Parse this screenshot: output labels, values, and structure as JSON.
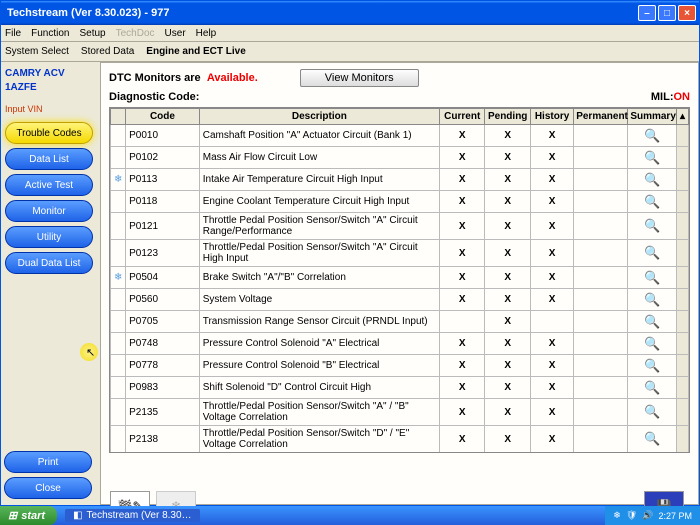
{
  "window": {
    "title": "Techstream (Ver 8.30.023) - 977"
  },
  "menubar": [
    "File",
    "Function",
    "Setup",
    "TechDoc",
    "User",
    "Help"
  ],
  "toolbar": {
    "items": [
      "System Select",
      "Stored Data",
      "Engine and ECT Live"
    ],
    "active": 2
  },
  "sidebar": {
    "vehicle_line1": "CAMRY ACV",
    "vehicle_line2": "1AZFE",
    "input_vin": "Input VIN",
    "buttons": [
      {
        "label": "Trouble Codes",
        "style": "yellow"
      },
      {
        "label": "Data List",
        "style": "blue"
      },
      {
        "label": "Active Test",
        "style": "blue"
      },
      {
        "label": "Monitor",
        "style": "blue"
      },
      {
        "label": "Utility",
        "style": "blue"
      },
      {
        "label": "Dual Data List",
        "style": "blue"
      }
    ],
    "bottom": [
      {
        "label": "Print"
      },
      {
        "label": "Close"
      }
    ]
  },
  "main": {
    "dtc_label": "DTC Monitors are",
    "dtc_status": "Available.",
    "view_monitors": "View Monitors",
    "diag_label": "Diagnostic Code:",
    "mil_label": "MIL:",
    "mil_value": "ON",
    "columns": [
      "",
      "Code",
      "Description",
      "Current",
      "Pending",
      "History",
      "Permanent",
      "Summary"
    ],
    "rows": [
      {
        "code": "P0010",
        "desc": "Camshaft Position \"A\" Actuator Circuit (Bank 1)",
        "cur": "X",
        "pen": "X",
        "his": "X",
        "flag": ""
      },
      {
        "code": "P0102",
        "desc": "Mass Air Flow Circuit Low",
        "cur": "X",
        "pen": "X",
        "his": "X",
        "flag": ""
      },
      {
        "code": "P0113",
        "desc": "Intake Air Temperature Circuit High Input",
        "cur": "X",
        "pen": "X",
        "his": "X",
        "flag": "snow"
      },
      {
        "code": "P0118",
        "desc": "Engine Coolant Temperature Circuit High Input",
        "cur": "X",
        "pen": "X",
        "his": "X",
        "flag": ""
      },
      {
        "code": "P0121",
        "desc": "Throttle Pedal Position Sensor/Switch \"A\" Circuit Range/Performance",
        "cur": "X",
        "pen": "X",
        "his": "X",
        "flag": ""
      },
      {
        "code": "P0123",
        "desc": "Throttle/Pedal Position Sensor/Switch \"A\" Circuit High Input",
        "cur": "X",
        "pen": "X",
        "his": "X",
        "flag": ""
      },
      {
        "code": "P0504",
        "desc": "Brake Switch \"A\"/\"B\" Correlation",
        "cur": "X",
        "pen": "X",
        "his": "X",
        "flag": "snow"
      },
      {
        "code": "P0560",
        "desc": "System Voltage",
        "cur": "X",
        "pen": "X",
        "his": "X",
        "flag": ""
      },
      {
        "code": "P0705",
        "desc": "Transmission Range Sensor Circuit (PRNDL Input)",
        "cur": "",
        "pen": "X",
        "his": "",
        "flag": ""
      },
      {
        "code": "P0748",
        "desc": "Pressure Control Solenoid \"A\" Electrical",
        "cur": "X",
        "pen": "X",
        "his": "X",
        "flag": ""
      },
      {
        "code": "P0778",
        "desc": "Pressure Control Solenoid \"B\" Electrical",
        "cur": "X",
        "pen": "X",
        "his": "X",
        "flag": ""
      },
      {
        "code": "P0983",
        "desc": "Shift Solenoid \"D\" Control Circuit High",
        "cur": "X",
        "pen": "X",
        "his": "X",
        "flag": ""
      },
      {
        "code": "P2135",
        "desc": "Throttle/Pedal Position Sensor/Switch \"A\" / \"B\" Voltage Correlation",
        "cur": "X",
        "pen": "X",
        "his": "X",
        "flag": ""
      },
      {
        "code": "P2138",
        "desc": "Throttle/Pedal Position Sensor/Switch \"D\" / \"E\" Voltage Correlation",
        "cur": "X",
        "pen": "X",
        "his": "X",
        "flag": ""
      }
    ]
  },
  "taskbar": {
    "start": "start",
    "task": "Techstream (Ver 8.30…",
    "time": "2:27 PM"
  }
}
